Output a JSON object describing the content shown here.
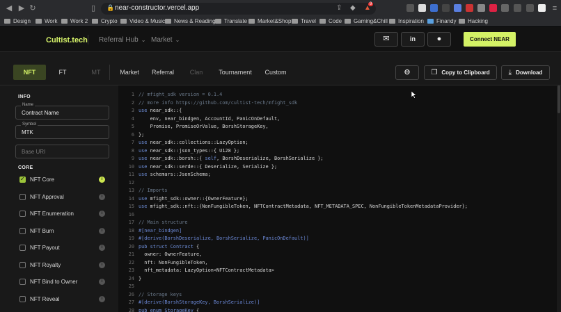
{
  "browser": {
    "url": "near-constructor.vercel.app",
    "tab_badge": "9",
    "bookmarks": [
      "Design",
      "Work",
      "Work 2",
      "Crypto",
      "Video & Music",
      "News & Reading",
      "Translate",
      "Market&Shop",
      "Travel",
      "Code",
      "Gaming&Chill",
      "Inspiration",
      "Finandy",
      "Hacking"
    ]
  },
  "header": {
    "brand": "Cultist.tech",
    "menus": [
      {
        "label": "Referral Hub"
      },
      {
        "label": "Market"
      }
    ],
    "connect_label": "Connect NEAR",
    "icons": [
      "mail-icon",
      "linkedin-icon",
      "github-icon"
    ]
  },
  "tabs": [
    {
      "label": "NFT",
      "state": "active"
    },
    {
      "label": "FT",
      "state": "normal"
    },
    {
      "label": "MT",
      "state": "disabled"
    },
    {
      "label": "Market",
      "state": "normal"
    },
    {
      "label": "Referral",
      "state": "normal"
    },
    {
      "label": "Clan",
      "state": "disabled"
    },
    {
      "label": "Tournament",
      "state": "normal"
    },
    {
      "label": "Custom",
      "state": "normal"
    }
  ],
  "actions": {
    "link_icon": "link-icon",
    "copy_label": "Copy to Clipboard",
    "download_label": "Download"
  },
  "sidebar": {
    "info_title": "INFO",
    "fields": [
      {
        "label": "Name",
        "value": "Contract Name"
      },
      {
        "label": "Symbol",
        "value": "MTK"
      },
      {
        "placeholder": "Base URI"
      }
    ],
    "core_title": "CORE",
    "options": [
      {
        "label": "NFT Core",
        "checked": true
      },
      {
        "label": "NFT Approval",
        "checked": false
      },
      {
        "label": "NFT Enumeration",
        "checked": false
      },
      {
        "label": "NFT Burn",
        "checked": false
      },
      {
        "label": "NFT Payout",
        "checked": false
      },
      {
        "label": "NFT Royalty",
        "checked": false
      },
      {
        "label": "NFT Bind to Owner",
        "checked": false
      },
      {
        "label": "NFT Reveal",
        "checked": false
      }
    ]
  },
  "code": [
    {
      "n": "1",
      "parts": [
        [
          "c",
          "// mfight_sdk version = 0.1.4"
        ]
      ]
    },
    {
      "n": "2",
      "parts": [
        [
          "c",
          "// more info https://github.com/cultist-tech/mfight_sdk"
        ]
      ]
    },
    {
      "n": "3",
      "parts": [
        [
          "k",
          "use"
        ],
        [
          "p",
          " near_sdk::{"
        ]
      ]
    },
    {
      "n": "4",
      "parts": [
        [
          "p",
          "    env, near_bindgen, AccountId, PanicOnDefault,"
        ]
      ]
    },
    {
      "n": "5",
      "parts": [
        [
          "p",
          "    Promise, PromiseOrValue, BorshStorageKey,"
        ]
      ]
    },
    {
      "n": "6",
      "parts": [
        [
          "p",
          "};"
        ]
      ]
    },
    {
      "n": "7",
      "parts": [
        [
          "k",
          "use"
        ],
        [
          "p",
          " near_sdk::collections::LazyOption;"
        ]
      ]
    },
    {
      "n": "8",
      "parts": [
        [
          "k",
          "use"
        ],
        [
          "p",
          " near_sdk::json_types::{ U128 };"
        ]
      ]
    },
    {
      "n": "9",
      "parts": [
        [
          "k",
          "use"
        ],
        [
          "p",
          " near_sdk::borsh::{ "
        ],
        [
          "k",
          "self"
        ],
        [
          "p",
          ", BorshDeserialize, BorshSerialize };"
        ]
      ]
    },
    {
      "n": "10",
      "parts": [
        [
          "k",
          "use"
        ],
        [
          "p",
          " near_sdk::serde::{ Deserialize, Serialize };"
        ]
      ]
    },
    {
      "n": "11",
      "parts": [
        [
          "k",
          "use"
        ],
        [
          "p",
          " schemars::JsonSchema;"
        ]
      ]
    },
    {
      "n": "12",
      "parts": []
    },
    {
      "n": "13",
      "parts": [
        [
          "c",
          "// Imports"
        ]
      ]
    },
    {
      "n": "14",
      "parts": [
        [
          "k",
          "use"
        ],
        [
          "p",
          " mfight_sdk::owner::{OwnerFeature};"
        ]
      ]
    },
    {
      "n": "15",
      "parts": [
        [
          "k",
          "use"
        ],
        [
          "p",
          " mfight_sdk::nft::{NonFungibleToken, NFTContractMetadata, NFT_METADATA_SPEC, NonFungibleTokenMetadataProvider};"
        ]
      ]
    },
    {
      "n": "16",
      "parts": []
    },
    {
      "n": "17",
      "parts": [
        [
          "c",
          "// Main structure"
        ]
      ]
    },
    {
      "n": "18",
      "parts": [
        [
          "a",
          "#[near_bindgen]"
        ]
      ]
    },
    {
      "n": "19",
      "parts": [
        [
          "a",
          "#[derive(BorshDeserialize, BorshSerialize, PanicOnDefault)]"
        ]
      ]
    },
    {
      "n": "20",
      "parts": [
        [
          "k",
          "pub struct"
        ],
        [
          "p",
          " "
        ],
        [
          "k",
          "Contract"
        ],
        [
          "p",
          " {"
        ]
      ]
    },
    {
      "n": "21",
      "parts": [
        [
          "p",
          "  owner: OwnerFeature,"
        ]
      ]
    },
    {
      "n": "22",
      "parts": [
        [
          "p",
          "  nft: NonFungibleToken,"
        ]
      ]
    },
    {
      "n": "23",
      "parts": [
        [
          "p",
          "  nft_metadata: LazyOption<NFTContractMetadata>"
        ]
      ]
    },
    {
      "n": "24",
      "parts": [
        [
          "p",
          "}"
        ]
      ]
    },
    {
      "n": "25",
      "parts": []
    },
    {
      "n": "26",
      "parts": [
        [
          "c",
          "// Storage keys"
        ]
      ]
    },
    {
      "n": "27",
      "parts": [
        [
          "a",
          "#[derive(BorshStorageKey, BorshSerialize)]"
        ]
      ]
    },
    {
      "n": "28",
      "parts": [
        [
          "k",
          "pub enum"
        ],
        [
          "p",
          " "
        ],
        [
          "k",
          "StorageKey"
        ],
        [
          "p",
          " {"
        ]
      ]
    }
  ],
  "colors": {
    "accent": "#d4f266",
    "active_tab_bg": "#3a4522",
    "keyword": "#6e8ed8",
    "comment": "#6b7a8c"
  }
}
